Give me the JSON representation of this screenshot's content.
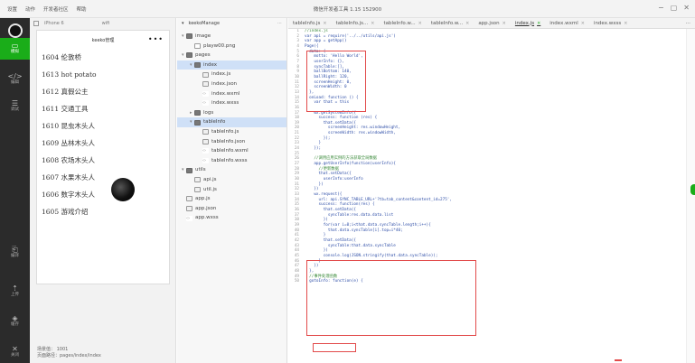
{
  "menu": [
    "设置",
    "动作",
    "开发者社区",
    "帮助"
  ],
  "window": {
    "title": "微信开发者工具 1.15 152900"
  },
  "window_controls": [
    "−",
    "▢",
    "✕"
  ],
  "activity": [
    {
      "icon": "mobile-icon",
      "glyph": "▭",
      "label": "模拟"
    },
    {
      "icon": "code-icon",
      "glyph": "</>",
      "label": "编辑"
    },
    {
      "icon": "debug-icon",
      "glyph": "☰",
      "label": "调试"
    },
    {
      "icon": "compile-icon",
      "glyph": "⎗",
      "label": "编译"
    },
    {
      "icon": "upload-icon",
      "glyph": "⇡",
      "label": "上传"
    },
    {
      "icon": "cache-icon",
      "glyph": "◈",
      "label": "缓存"
    },
    {
      "icon": "close-icon",
      "glyph": "✕",
      "label": "关闭"
    }
  ],
  "simulator": {
    "device": "iPhone 6",
    "network": "wifi",
    "nav_title": "keeko管理",
    "nav_dots": "•••",
    "items": [
      "1604 伦敦桥",
      "1613 hot potato",
      "1612 真假公主",
      "1611 交通工具",
      "1610 昆虫木头人",
      "1609 丛林木头人",
      "1608 农场木头人",
      "1607 水果木头人",
      "1606 数字木头人",
      "1605 游戏介绍"
    ],
    "status_line1": "场景值：  1001",
    "status_line2": "页面路径：pages/index/index"
  },
  "explorer": {
    "title": "keekoManage",
    "more": "⋯",
    "nodes": [
      {
        "depth": 0,
        "type": "folder",
        "name": "image",
        "arrow": "▾"
      },
      {
        "depth": 1,
        "type": "img",
        "name": "playw00.png"
      },
      {
        "depth": 0,
        "type": "folder",
        "name": "pages",
        "arrow": "▾"
      },
      {
        "depth": 1,
        "type": "folder",
        "name": "index",
        "arrow": "▾",
        "selected": true
      },
      {
        "depth": 2,
        "type": "js",
        "name": "index.js"
      },
      {
        "depth": 2,
        "type": "js",
        "name": "index.json"
      },
      {
        "depth": 2,
        "type": "wxml",
        "name": "index.wxml"
      },
      {
        "depth": 2,
        "type": "wxml",
        "name": "index.wxss"
      },
      {
        "depth": 1,
        "type": "folder",
        "name": "logs",
        "arrow": "▸"
      },
      {
        "depth": 1,
        "type": "folder",
        "name": "tableInfo",
        "arrow": "▾",
        "selected": true
      },
      {
        "depth": 2,
        "type": "js",
        "name": "tableInfo.js"
      },
      {
        "depth": 2,
        "type": "js",
        "name": "tableInfo.json"
      },
      {
        "depth": 2,
        "type": "wxml",
        "name": "tableInfo.wxml"
      },
      {
        "depth": 2,
        "type": "wxml",
        "name": "tableInfo.wxss"
      },
      {
        "depth": 0,
        "type": "folder",
        "name": "utils",
        "arrow": "▾"
      },
      {
        "depth": 1,
        "type": "js",
        "name": "api.js"
      },
      {
        "depth": 1,
        "type": "js",
        "name": "util.js"
      },
      {
        "depth": 0,
        "type": "js",
        "name": "app.js"
      },
      {
        "depth": 0,
        "type": "js",
        "name": "app.json"
      },
      {
        "depth": 0,
        "type": "wxml",
        "name": "app.wxss"
      }
    ]
  },
  "tabs": [
    {
      "label": "tableInfo.js"
    },
    {
      "label": "tableInfo.js..."
    },
    {
      "label": "tableInfo.w..."
    },
    {
      "label": "tableInfo.w..."
    },
    {
      "label": "app.json"
    },
    {
      "label": "index.js",
      "active": true
    },
    {
      "label": "index.wxml"
    },
    {
      "label": "index.wxss"
    }
  ],
  "tab_more": "⋯",
  "editor": {
    "lines": [
      "//index.js",
      "var api = require('../../utils/api.js')",
      "var app = getApp()",
      "Page({",
      "  data: {",
      "    motto: 'Hello World',",
      "    userInfo: {},",
      "    syncTable:[],",
      "    ballBottom: 140,",
      "    ballRight: 120,",
      "    screenHeight: 0,",
      "    screenWidth: 0",
      "  },",
      "  onLoad: function () {",
      "    var that = this",
      "",
      "    wx.getSystemInfo({",
      "      success: function (res) {",
      "        that.setData({",
      "          screenHeight: res.windowHeight,",
      "          screenWidth: res.windowWidth,",
      "        });",
      "      }",
      "    });",
      "",
      "    //调用应用实例的方法获取全局数据",
      "    app.getUserInfo(function(userInfo){",
      "      //更新数据",
      "      that.setData({",
      "        userInfo:userInfo",
      "      })",
      "    })",
      "    wx.request({",
      "      url: api.SYNC_TABLE_URL+'?tb=tab_content&content_id=275',",
      "      success: function(res) {",
      "        that.setData({",
      "          syncTable:res.data.data.list",
      "        })",
      "        for(var i=0;i<that.data.syncTable.length;i++){",
      "          that.data.syncTable[i].top=i*40;",
      "        }",
      "        that.setData({",
      "          syncTable:that.data.syncTable",
      "        })",
      "        console.log(JSON.stringify(that.data.syncTable));",
      "      }",
      "    })",
      "  },",
      "  //事件处理函数",
      "  gotoInfo: function(e) {"
    ]
  }
}
